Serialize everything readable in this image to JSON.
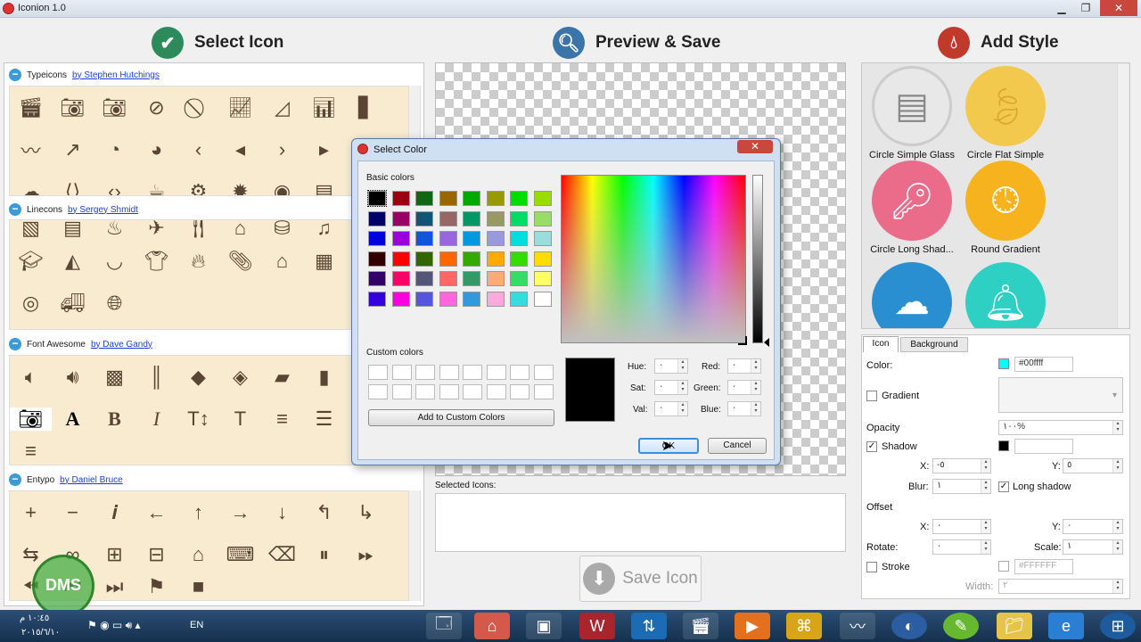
{
  "window": {
    "title": "Iconion 1.0"
  },
  "sections": {
    "select": "Select Icon",
    "preview": "Preview & Save",
    "style": "Add Style"
  },
  "libraries": [
    {
      "name": "Typeicons",
      "author": "by Stephen Hutchings"
    },
    {
      "name": "Linecons",
      "author": "by Sergey Shmidt"
    },
    {
      "name": "Font Awesome",
      "author": "by Dave Gandy"
    },
    {
      "name": "Entypo",
      "author": "by Daniel Bruce"
    }
  ],
  "selected_icons_label": "Selected Icons:",
  "save_button": "Save Icon",
  "styles": [
    {
      "name": "Circle Simple Glass",
      "color": "#e8e8e8"
    },
    {
      "name": "Circle Flat Simple",
      "color": "#f2c94c"
    },
    {
      "name": "Circle Long Shad...",
      "color": "#ea6c8a"
    },
    {
      "name": "Round Gradient",
      "color": "#f7b31d"
    }
  ],
  "tabs": {
    "icon": "Icon",
    "background": "Background"
  },
  "props": {
    "color_label": "Color:",
    "color_value": "#00ffff",
    "color_hex": "#00ffff",
    "gradient": "Gradient",
    "opacity": "Opacity",
    "opacity_value": "١٠٠%",
    "shadow": "Shadow",
    "x": "X:",
    "y": "Y:",
    "shadow_x": "-٥",
    "shadow_y": "٥",
    "blur": "Blur:",
    "blur_value": "١",
    "long_shadow": "Long shadow",
    "offset": "Offset",
    "offset_x": "٠",
    "offset_y": "٠",
    "rotate": "Rotate:",
    "rotate_value": "٠",
    "scale": "Scale:",
    "scale_value": "١",
    "stroke": "Stroke",
    "stroke_value": "#FFFFFF",
    "width": "Width:",
    "width_value": "٢"
  },
  "dialog": {
    "title": "Select Color",
    "basic_colors": "Basic colors",
    "custom_colors": "Custom colors",
    "add_custom": "Add to Custom Colors",
    "ok": "OK",
    "cancel": "Cancel",
    "hue": "Hue:",
    "sat": "Sat:",
    "val": "Val:",
    "red": "Red:",
    "green": "Green:",
    "blue": "Blue:",
    "hue_v": "٠",
    "sat_v": "٠",
    "val_v": "٠",
    "red_v": "٠",
    "green_v": "٠",
    "blue_v": "٠",
    "palette": [
      "#000000",
      "#990011",
      "#116611",
      "#996600",
      "#00aa00",
      "#999900",
      "#00dd00",
      "#99dd00",
      "#000066",
      "#990066",
      "#115577",
      "#996666",
      "#009966",
      "#999966",
      "#00dd66",
      "#99dd66",
      "#0000dd",
      "#9900dd",
      "#1155dd",
      "#9966dd",
      "#0099dd",
      "#9999dd",
      "#00dddd",
      "#99dddd",
      "#330000",
      "#ff0000",
      "#336600",
      "#ff6600",
      "#33aa00",
      "#ffaa00",
      "#33dd00",
      "#ffdd00",
      "#330066",
      "#ff0066",
      "#555577",
      "#ff6666",
      "#339966",
      "#ffaa77",
      "#33dd66",
      "#ffff66",
      "#3300dd",
      "#ff00dd",
      "#5555dd",
      "#ff66dd",
      "#3399dd",
      "#ffaadd",
      "#33dddd",
      "#ffffff"
    ]
  },
  "taskbar": {
    "lang": "EN",
    "time": "١٠:٤٥ م",
    "date": "٢٠١٥/٦/١٠"
  }
}
